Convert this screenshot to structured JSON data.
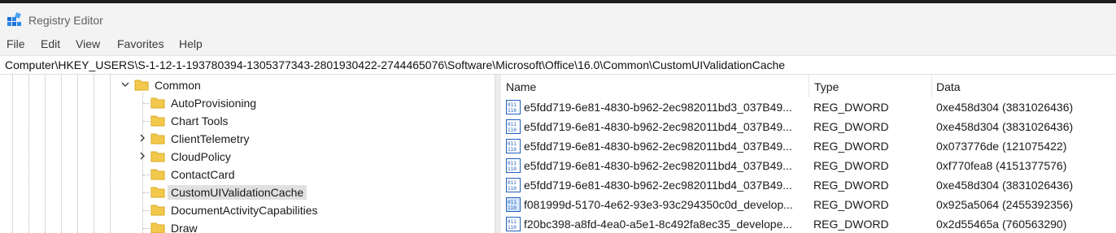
{
  "window": {
    "title": "Registry Editor"
  },
  "menu": [
    "File",
    "Edit",
    "View",
    "Favorites",
    "Help"
  ],
  "address": "Computer\\HKEY_USERS\\S-1-12-1-193780394-1305377343-2801930422-2744465076\\Software\\Microsoft\\Office\\16.0\\Common\\CustomUIValidationCache",
  "tree": {
    "parent": {
      "label": "Common",
      "expanded": true
    },
    "children": [
      {
        "label": "AutoProvisioning",
        "has_children": false,
        "selected": false
      },
      {
        "label": "Chart Tools",
        "has_children": false,
        "selected": false
      },
      {
        "label": "ClientTelemetry",
        "has_children": true,
        "selected": false
      },
      {
        "label": "CloudPolicy",
        "has_children": true,
        "selected": false
      },
      {
        "label": "ContactCard",
        "has_children": false,
        "selected": false
      },
      {
        "label": "CustomUIValidationCache",
        "has_children": false,
        "selected": true
      },
      {
        "label": "DocumentActivityCapabilities",
        "has_children": false,
        "selected": false
      },
      {
        "label": "Draw",
        "has_children": false,
        "selected": false
      }
    ]
  },
  "values": {
    "headers": {
      "name": "Name",
      "type": "Type",
      "data": "Data"
    },
    "rows": [
      {
        "name": "e5fdd719-6e81-4830-b962-2ec982011bd3_037B49...",
        "type": "REG_DWORD",
        "data": "0xe458d304 (3831026436)",
        "icon": "binary-value-icon"
      },
      {
        "name": "e5fdd719-6e81-4830-b962-2ec982011bd4_037B49...",
        "type": "REG_DWORD",
        "data": "0xe458d304 (3831026436)",
        "icon": "binary-value-icon"
      },
      {
        "name": "e5fdd719-6e81-4830-b962-2ec982011bd4_037B49...",
        "type": "REG_DWORD",
        "data": "0x073776de (121075422)",
        "icon": "binary-value-icon"
      },
      {
        "name": "e5fdd719-6e81-4830-b962-2ec982011bd4_037B49...",
        "type": "REG_DWORD",
        "data": "0xf770fea8 (4151377576)",
        "icon": "binary-value-icon"
      },
      {
        "name": "e5fdd719-6e81-4830-b962-2ec982011bd4_037B49...",
        "type": "REG_DWORD",
        "data": "0xe458d304 (3831026436)",
        "icon": "binary-value-icon"
      },
      {
        "name": "f081999d-5170-4e62-93e3-93c294350c0d_develop...",
        "type": "REG_DWORD",
        "data": "0x925a5064 (2455392356)",
        "icon": "binary-value-icon"
      },
      {
        "name": "f20bc398-a8fd-4ea0-a5e1-8c492fa8ec35_develope...",
        "type": "REG_DWORD",
        "data": "0x2d55465a (760563290)",
        "icon": "binary-value-icon"
      }
    ]
  },
  "colors": {
    "folder": "#f2c94c",
    "folder_dark": "#dba920",
    "value_icon": "#1f5fbf",
    "selection": "#e0e0e0"
  }
}
